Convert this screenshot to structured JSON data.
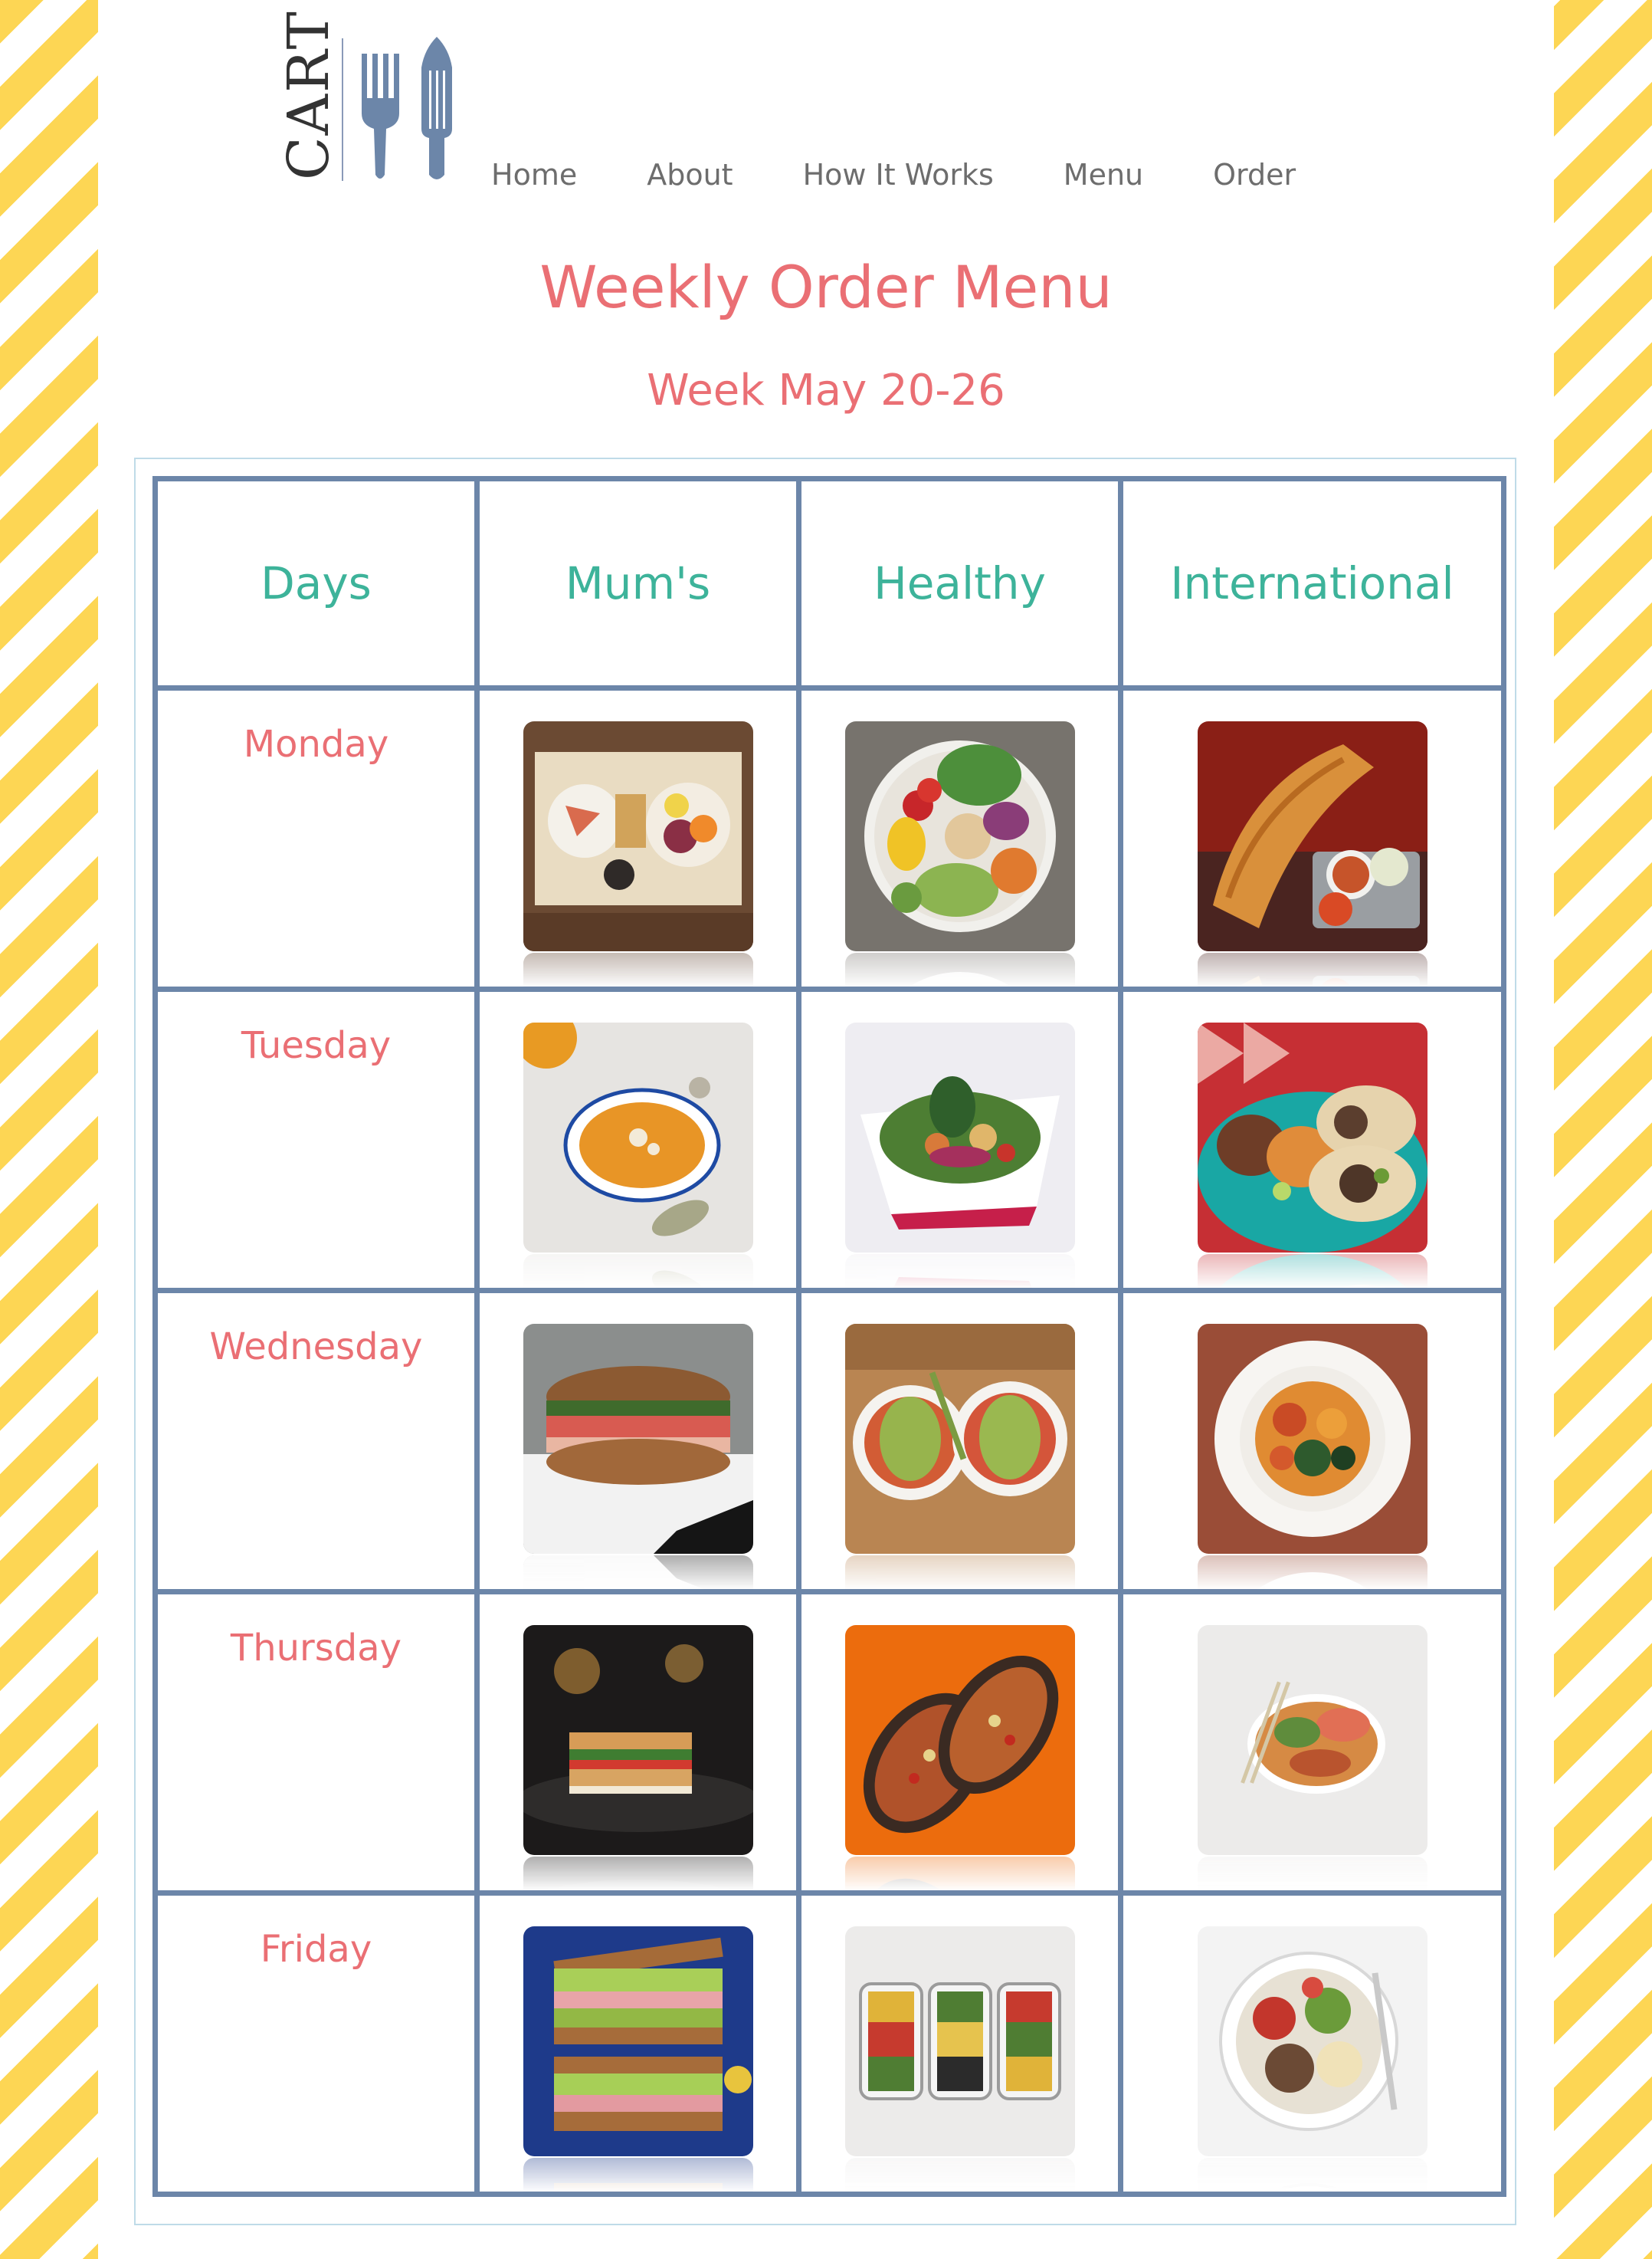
{
  "logo": {
    "text": "CART"
  },
  "nav": {
    "items": [
      "Home",
      "About",
      "How It Works",
      "Menu",
      "Order"
    ]
  },
  "title": "Weekly Order Menu",
  "subtitle": "Week May 20-26",
  "table": {
    "headers": [
      "Days",
      "Mum's",
      "Healthy",
      "International"
    ],
    "rows": [
      {
        "day": "Monday"
      },
      {
        "day": "Tuesday"
      },
      {
        "day": "Wednesday"
      },
      {
        "day": "Thursday"
      },
      {
        "day": "Friday"
      }
    ]
  },
  "colors": {
    "accent_title": "#ea6f74",
    "header_text": "#3db39a",
    "table_border": "#6c86a9",
    "stripe": "#fdd654"
  }
}
